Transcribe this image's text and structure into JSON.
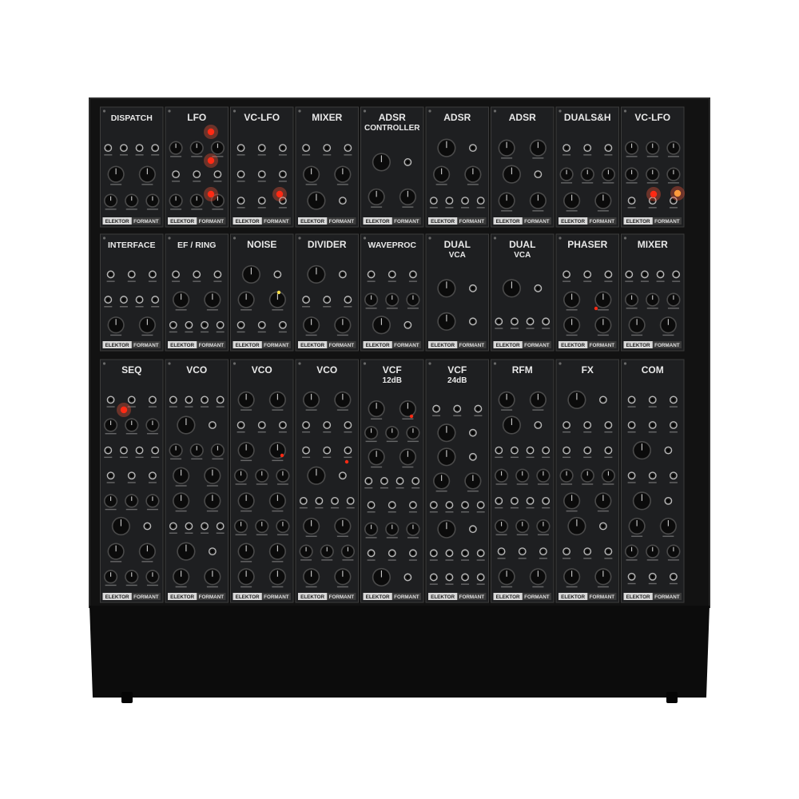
{
  "brand": [
    "ELEKTOR",
    "FORMANT"
  ],
  "colors": {
    "background": "#ffffff",
    "case": "#121212",
    "case_edge": "#2a2a2a",
    "panel": "#1e1f21",
    "panel_border": "#3c3c3c",
    "label_white": "#e8e8e8",
    "label_grey": "#9a9a9a",
    "knob": "#0b0b0b",
    "knob_ring": "#4a4a4a",
    "jack": "#1a1a1a",
    "jack_ring": "#b8b8b8",
    "led_red": "#ff2a14",
    "led_glow": "#ff5a3c",
    "led_yellow": "#ffe24a",
    "led_orange": "#ff9a3c",
    "brand_bar": "#d9d9d9",
    "brand_text": "#202020",
    "base": "#0c0c0c"
  },
  "rows": [
    {
      "modules": [
        {
          "title": [
            "DISPATCH"
          ]
        },
        {
          "title": [
            "LFO"
          ]
        },
        {
          "title": [
            "VC-LFO"
          ]
        },
        {
          "title": [
            "MIXER"
          ]
        },
        {
          "title": [
            "ADSR",
            "CONTROLLER"
          ]
        },
        {
          "title": [
            "ADSR"
          ]
        },
        {
          "title": [
            "ADSR"
          ]
        },
        {
          "title": [
            "DUALS&H"
          ]
        },
        {
          "title": [
            "VC-LFO"
          ]
        }
      ]
    },
    {
      "modules": [
        {
          "title": [
            "INTERFACE"
          ]
        },
        {
          "title": [
            "EF / RING"
          ]
        },
        {
          "title": [
            "NOISE"
          ]
        },
        {
          "title": [
            "DIVIDER"
          ]
        },
        {
          "title": [
            "WAVEPROC"
          ]
        },
        {
          "title": [
            "DUAL",
            "VCA"
          ]
        },
        {
          "title": [
            "DUAL",
            "VCA"
          ]
        },
        {
          "title": [
            "PHASER"
          ]
        },
        {
          "title": [
            "MIXER"
          ]
        }
      ]
    },
    {
      "modules": [
        {
          "title": [
            "SEQ"
          ]
        },
        {
          "title": [
            "VCO"
          ]
        },
        {
          "title": [
            "VCO"
          ]
        },
        {
          "title": [
            "VCO"
          ]
        },
        {
          "title": [
            "VCF",
            "12dB"
          ]
        },
        {
          "title": [
            "VCF",
            "24dB"
          ]
        },
        {
          "title": [
            "RFM"
          ]
        },
        {
          "title": [
            "FX"
          ]
        },
        {
          "title": [
            "COM"
          ]
        }
      ]
    }
  ]
}
